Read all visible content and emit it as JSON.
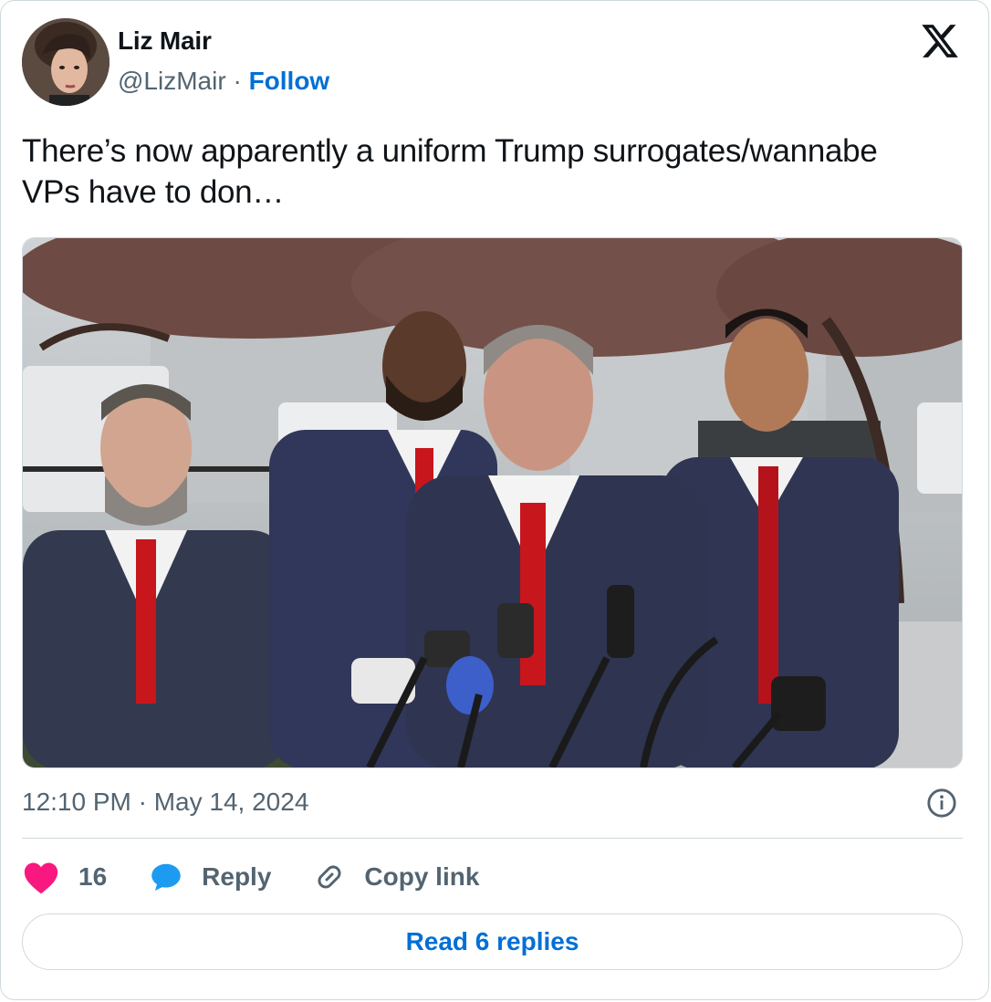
{
  "author": {
    "name": "Liz Mair",
    "handle": "@LizMair",
    "separator": " · ",
    "follow_label": "Follow"
  },
  "tweet": {
    "text": "There’s now apparently a uniform Trump surrogates/wannabe VPs have to don…",
    "timestamp": "12:10 PM · May 14, 2024"
  },
  "actions": {
    "like_count": "16",
    "reply_label": "Reply",
    "copy_link_label": "Copy link"
  },
  "read_replies_label": "Read 6 replies",
  "colors": {
    "accent": "#006fd6",
    "like": "#f91880",
    "reply_bubble": "#1d9bf0",
    "secondary_text": "#536471",
    "border": "#cfd9de"
  },
  "icons": [
    "x-logo-icon",
    "info-icon",
    "heart-icon",
    "reply-bubble-icon",
    "link-icon"
  ]
}
